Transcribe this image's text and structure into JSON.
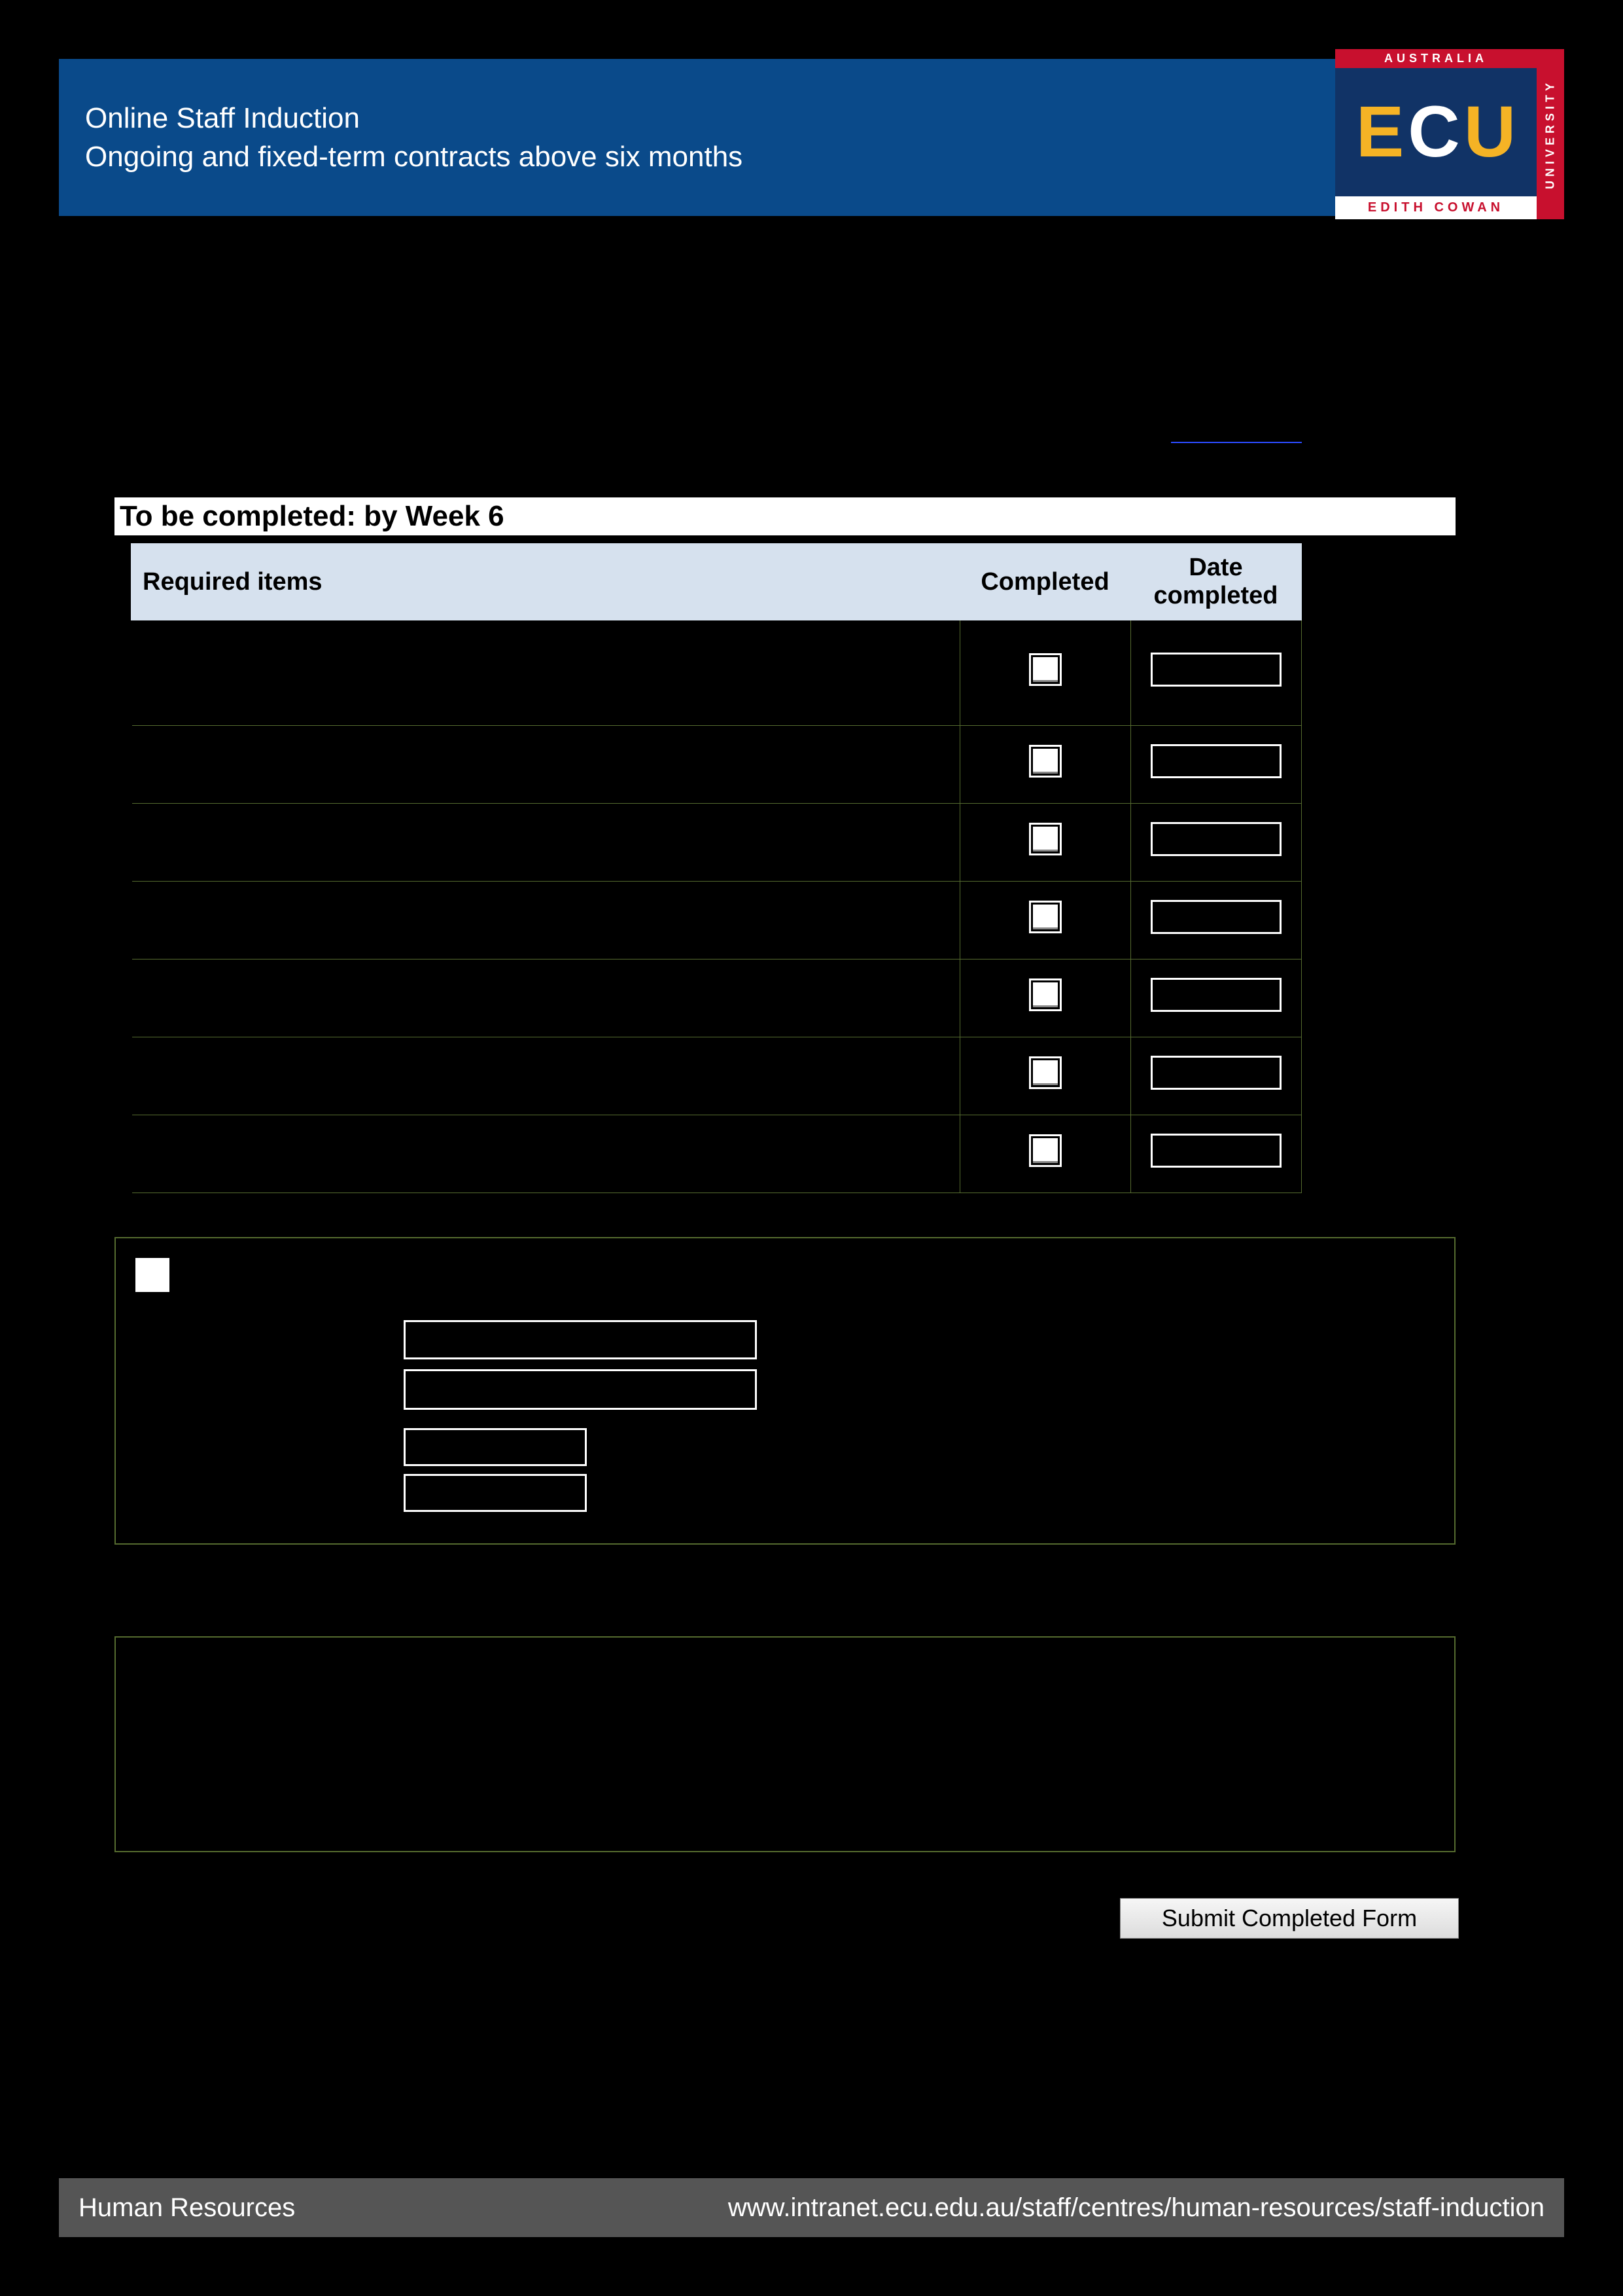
{
  "header": {
    "line1": "Online Staff Induction",
    "line2": "Ongoing and fixed-term contracts above six months"
  },
  "logo": {
    "top": "AUSTRALIA",
    "letters": [
      "E",
      "C",
      "U"
    ],
    "bottom": "EDITH COWAN",
    "side": "UNIVERSITY"
  },
  "section": {
    "title": "To be completed: by Week 6"
  },
  "table": {
    "headers": {
      "items": "Required items",
      "completed": "Completed",
      "date": "Date completed"
    },
    "rows": [
      {
        "item": ""
      },
      {
        "item": ""
      },
      {
        "item": ""
      },
      {
        "item": ""
      },
      {
        "item": ""
      },
      {
        "item": ""
      },
      {
        "item": ""
      }
    ]
  },
  "submit": {
    "label": "Submit Completed Form"
  },
  "footer": {
    "left": "Human Resources",
    "right": "www.intranet.ecu.edu.au/staff/centres/human-resources/staff-induction"
  }
}
